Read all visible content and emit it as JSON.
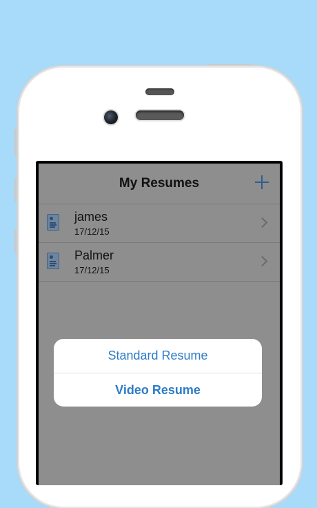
{
  "nav": {
    "title": "My Resumes",
    "add_icon": "plus-icon"
  },
  "resumes": [
    {
      "name": "james",
      "date": "17/12/15"
    },
    {
      "name": "Palmer",
      "date": "17/12/15"
    }
  ],
  "action_sheet": {
    "standard_label": "Standard Resume",
    "video_label": "Video Resume"
  },
  "colors": {
    "background": "#a8daf9",
    "accent": "#2e7bc7",
    "dimmed_screen": "#8e8e8e"
  }
}
